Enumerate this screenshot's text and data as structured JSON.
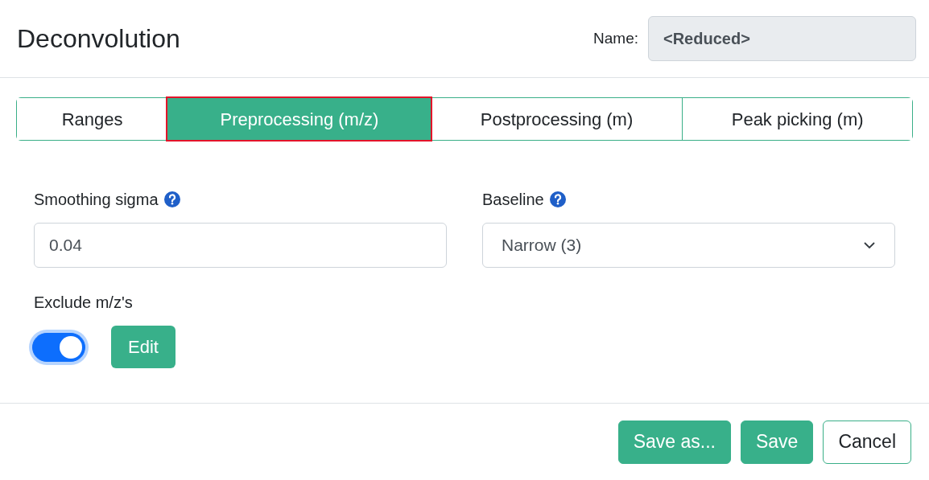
{
  "title": "Deconvolution",
  "name_field": {
    "label": "Name:",
    "value": "<Reduced>"
  },
  "tabs": [
    {
      "label": "Ranges",
      "selected": false
    },
    {
      "label": "Preprocessing (m/z)",
      "selected": true
    },
    {
      "label": "Postprocessing (m)",
      "selected": false
    },
    {
      "label": "Peak picking (m)",
      "selected": false
    }
  ],
  "smoothing": {
    "label": "Smoothing sigma",
    "value": "0.04"
  },
  "baseline": {
    "label": "Baseline",
    "value": "Narrow (3)"
  },
  "exclude": {
    "label": "Exclude m/z's",
    "on": true,
    "button": "Edit"
  },
  "buttons": [
    {
      "label": "Save as...",
      "kind": "primary"
    },
    {
      "label": "Save",
      "kind": "primary"
    },
    {
      "label": "Cancel",
      "kind": "secondary"
    }
  ]
}
